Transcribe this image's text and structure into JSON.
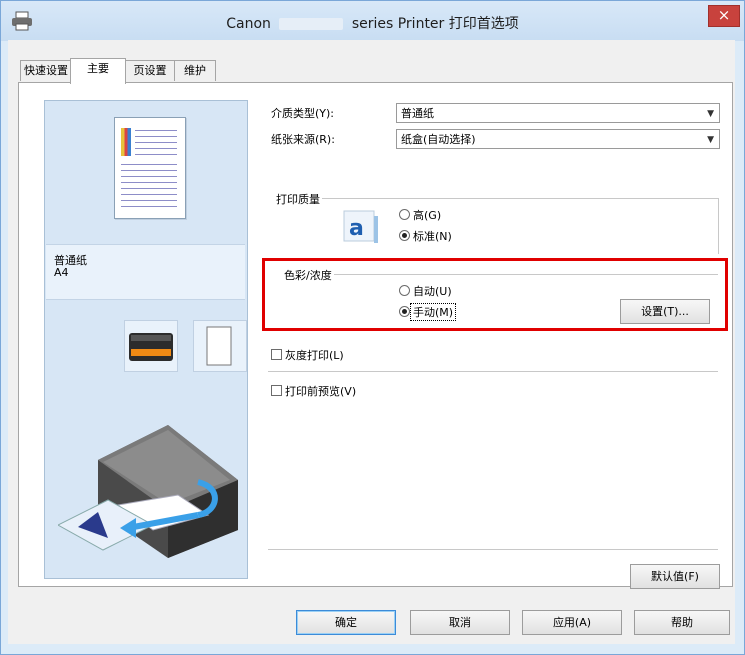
{
  "window": {
    "title_prefix": "Canon",
    "title_suffix": "series Printer 打印首选项",
    "close_label": "×"
  },
  "tabs": [
    {
      "label": "快速设置",
      "active": false
    },
    {
      "label": "主要",
      "active": true
    },
    {
      "label": "页设置",
      "active": false
    },
    {
      "label": "维护",
      "active": false
    }
  ],
  "preview": {
    "media_name": "普通纸",
    "paper_size": "A4"
  },
  "settings": {
    "media_type_label": "介质类型(Y):",
    "media_type_value": "普通纸",
    "paper_source_label": "纸张来源(R):",
    "paper_source_value": "纸盒(自动选择)",
    "print_quality": {
      "title": "打印质量",
      "options": [
        "高(G)",
        "标准(N)"
      ],
      "selected": "标准(N)"
    },
    "color_intensity": {
      "title": "色彩/浓度",
      "options": [
        "自动(U)",
        "手动(M)"
      ],
      "selected": "手动(M)",
      "set_button": "设置(T)..."
    },
    "grayscale_label": "灰度打印(L)",
    "grayscale_checked": false,
    "preview_label": "打印前预览(V)",
    "preview_checked": false
  },
  "defaults_button": "默认值(F)",
  "footer": {
    "ok": "确定",
    "cancel": "取消",
    "apply": "应用(A)",
    "help": "帮助"
  },
  "colors": {
    "highlight": "#e00000",
    "preview_bg": "#d7e6f5",
    "titlebar": "#c8ddf2"
  }
}
